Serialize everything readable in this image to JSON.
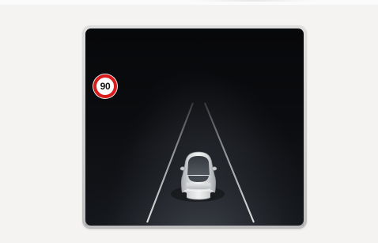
{
  "speed_limit": {
    "value": "90",
    "icon": "speed-limit-sign-icon",
    "ring_color": "#d81b1b"
  },
  "vehicle": {
    "icon": "ego-vehicle-car-icon"
  },
  "lanes": {
    "icon": "lane-lines-icon"
  }
}
